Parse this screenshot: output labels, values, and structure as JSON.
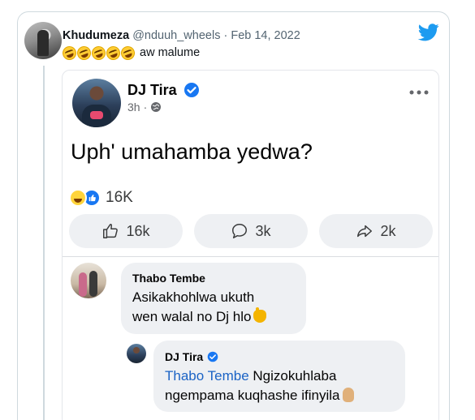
{
  "tweet": {
    "author_name": "Khudumeza",
    "author_handle": "@nduuh_wheels",
    "separator": " · ",
    "date": "Feb 14, 2022",
    "emoji_count": 5,
    "emoji_name": "rolling-on-floor-laughing",
    "text": "aw malume"
  },
  "facebook_post": {
    "page_name": "DJ Tira",
    "time": "3h",
    "time_separator": "·",
    "post_text": "Uph' umahamba yedwa?",
    "reaction_total": "16K",
    "actions": [
      {
        "label": "16k",
        "icon": "like-icon"
      },
      {
        "label": "3k",
        "icon": "comment-icon"
      },
      {
        "label": "2k",
        "icon": "share-icon"
      }
    ],
    "comment": {
      "author": "Thabo Tembe",
      "line1": "Asikakhohlwa ukuth",
      "line2": "wen walal no Dj hlo"
    },
    "reply": {
      "author": "DJ Tira",
      "mention": "Thabo Tembe",
      "line1_rest": " Ngizokuhlaba",
      "line2": "ngempama kuqhashe ifinyila"
    }
  },
  "colors": {
    "twitter_blue": "#1d9bf0",
    "facebook_blue": "#1877f2",
    "mention_blue": "#1b63c5",
    "secondary_text": "#536471"
  }
}
